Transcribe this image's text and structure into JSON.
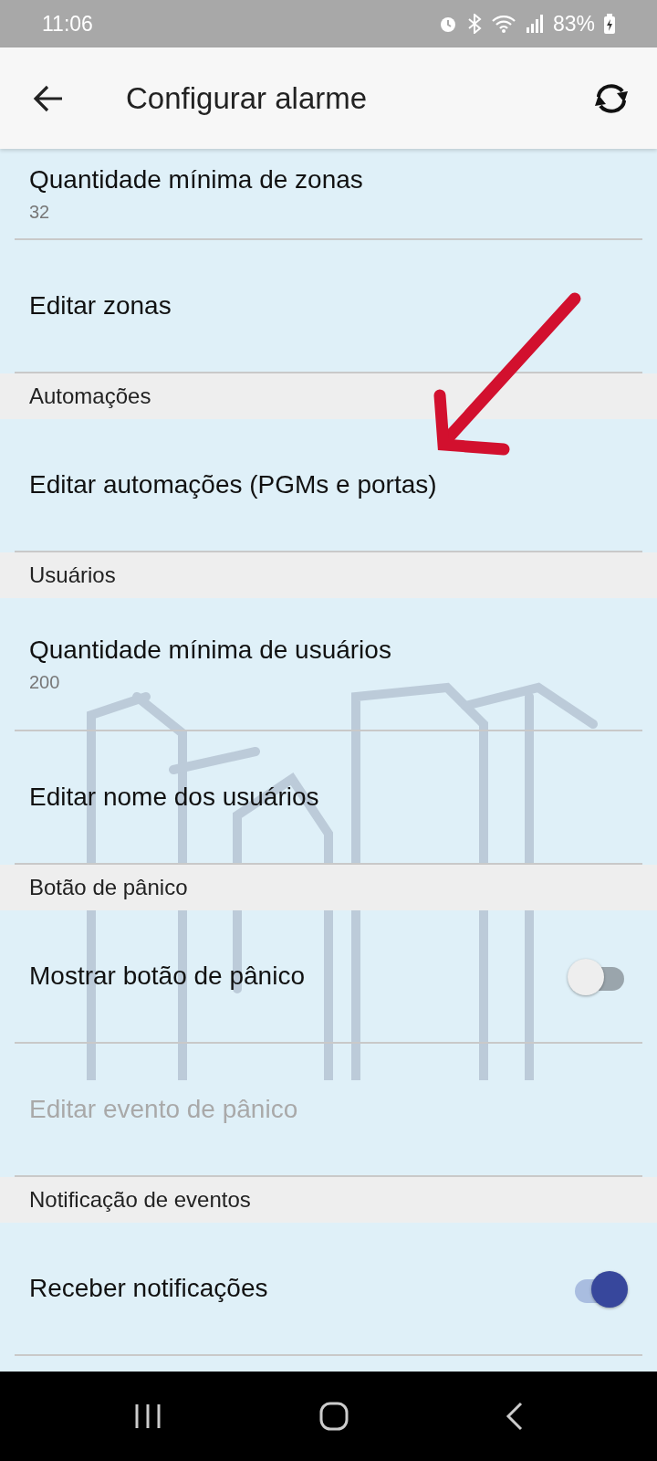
{
  "status_bar": {
    "time": "11:06",
    "battery": "83%"
  },
  "app_bar": {
    "title": "Configurar alarme"
  },
  "items": [
    {
      "kind": "item",
      "title": "Quantidade mínima de zonas",
      "subtitle": "32",
      "disabled": false
    },
    {
      "kind": "item",
      "title": "Editar zonas",
      "disabled": false
    },
    {
      "kind": "header",
      "title": "Automações"
    },
    {
      "kind": "item",
      "title": "Editar automações (PGMs e portas)",
      "disabled": false
    },
    {
      "kind": "header",
      "title": "Usuários"
    },
    {
      "kind": "item",
      "title": "Quantidade mínima de usuários",
      "subtitle": "200",
      "disabled": false
    },
    {
      "kind": "item",
      "title": "Editar nome dos usuários",
      "disabled": false
    },
    {
      "kind": "header",
      "title": "Botão de pânico"
    },
    {
      "kind": "toggle",
      "title": "Mostrar botão de pânico",
      "on": false,
      "disabled": false
    },
    {
      "kind": "item",
      "title": "Editar evento de pânico",
      "disabled": true
    },
    {
      "kind": "header",
      "title": "Notificação de eventos"
    },
    {
      "kind": "toggle",
      "title": "Receber notificações",
      "on": true,
      "disabled": false
    }
  ]
}
